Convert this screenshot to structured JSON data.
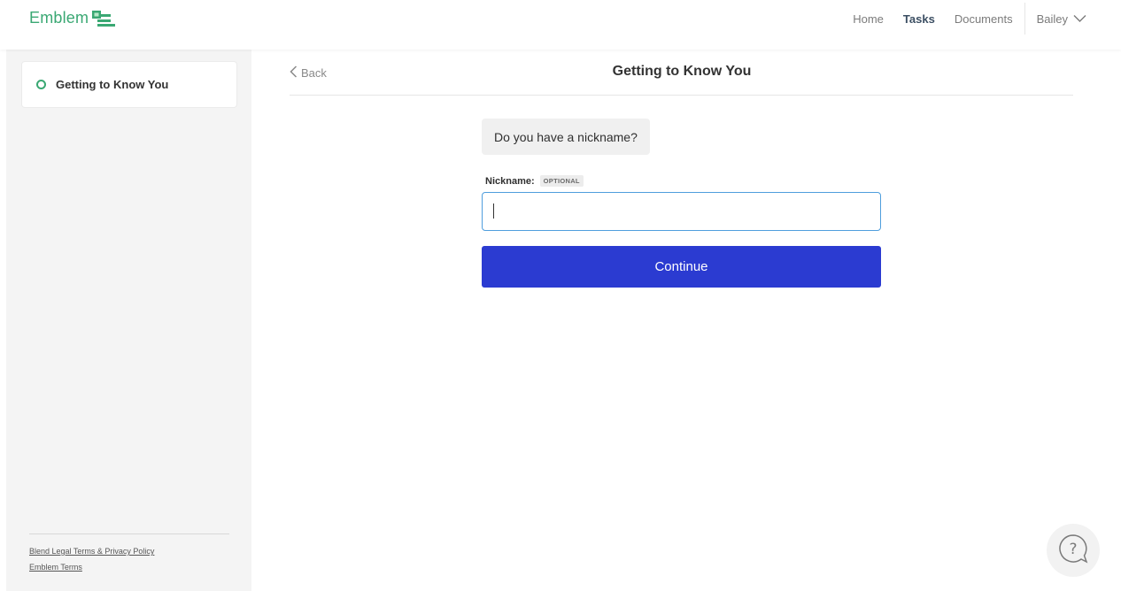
{
  "brand": {
    "name": "Emblem",
    "color": "#3aa873"
  },
  "nav": {
    "items": [
      {
        "label": "Home",
        "active": false
      },
      {
        "label": "Tasks",
        "active": true
      },
      {
        "label": "Documents",
        "active": false
      }
    ],
    "user": {
      "name": "Bailey",
      "icon": "chevron-down-icon"
    }
  },
  "sidebar": {
    "tasks": [
      {
        "label": "Getting to Know You",
        "status": "in-progress"
      }
    ],
    "legal_links": [
      "Blend Legal Terms & Privacy Policy",
      "Emblem Terms"
    ]
  },
  "main": {
    "back_label": "Back",
    "title": "Getting to Know You",
    "question": "Do you have a nickname?",
    "field": {
      "label": "Nickname:",
      "badge": "OPTIONAL",
      "value": "",
      "placeholder": ""
    },
    "continue_label": "Continue",
    "accent": "#2b3bd1"
  },
  "help": {
    "icon": "help-question-icon"
  }
}
